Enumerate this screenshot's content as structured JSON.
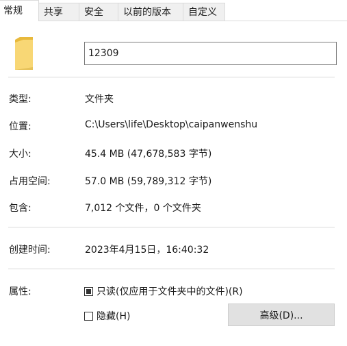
{
  "tabs": [
    {
      "label": "常规",
      "active": true
    },
    {
      "label": "共享",
      "active": false
    },
    {
      "label": "安全",
      "active": false
    },
    {
      "label": "以前的版本",
      "active": false
    },
    {
      "label": "自定义",
      "active": false
    }
  ],
  "header": {
    "icon": "folder-icon",
    "name_value": "12309"
  },
  "props": {
    "type_label": "类型:",
    "type_value": "文件夹",
    "location_label": "位置:",
    "location_value": "C:\\Users\\life\\Desktop\\caipanwenshu",
    "size_label": "大小:",
    "size_value": "45.4 MB (47,678,583 字节)",
    "size_on_disk_label": "占用空间:",
    "size_on_disk_value": "57.0 MB (59,789,312 字节)",
    "contains_label": "包含:",
    "contains_value": "7,012 个文件，0 个文件夹",
    "created_label": "创建时间:",
    "created_value": "2023年4月15日，16:40:32",
    "attributes_label": "属性:"
  },
  "attributes": {
    "readonly_label": "只读(仅应用于文件夹中的文件)(R)",
    "readonly_state": "indeterminate",
    "hidden_label": "隐藏(H)",
    "hidden_state": "unchecked",
    "advanced_button": "高级(D)..."
  },
  "colors": {
    "folder_front": "#f8d775",
    "folder_back": "#e8b93c",
    "button_bg": "#e1e1e1"
  }
}
